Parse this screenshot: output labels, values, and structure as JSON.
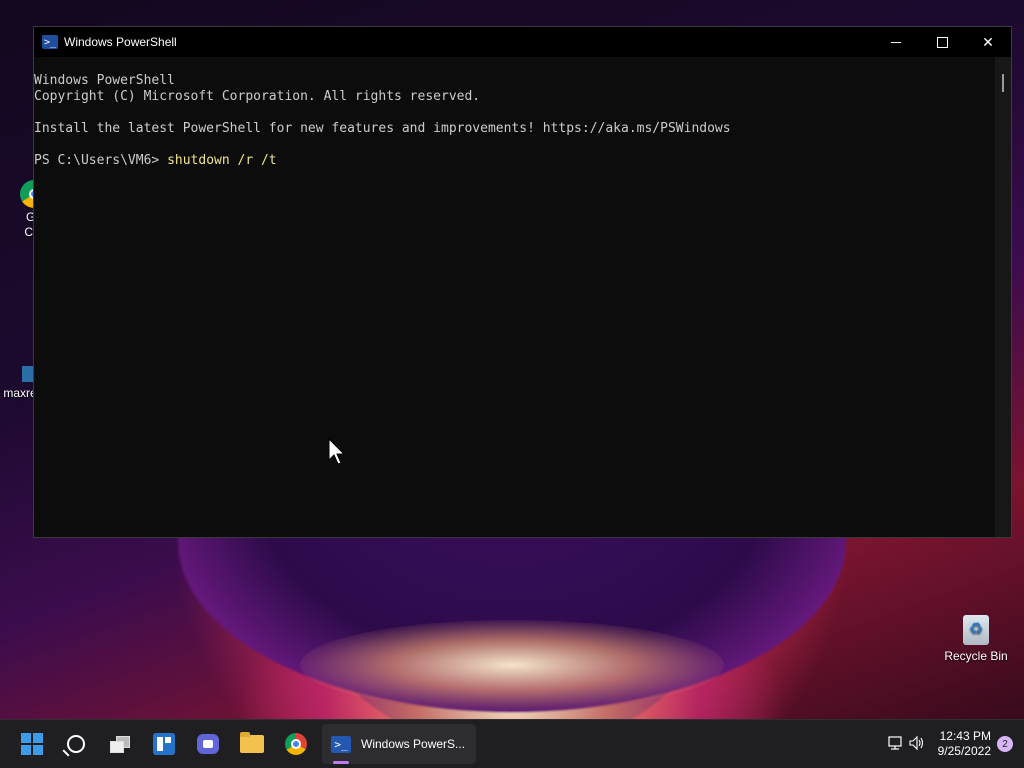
{
  "window": {
    "title": "Windows PowerShell",
    "buttons": {
      "minimize": "—",
      "maximize": "☐",
      "close": "✕"
    }
  },
  "console": {
    "lines": [
      "Windows PowerShell",
      "Copyright (C) Microsoft Corporation. All rights reserved.",
      "",
      "Install the latest PowerShell for new features and improvements! https://aka.ms/PSWindows",
      ""
    ],
    "prompt": "PS C:\\Users\\VM6> ",
    "command": "shutdown /r /t"
  },
  "desktop": {
    "icons": [
      {
        "label_line1": "Go",
        "label_line2": "Chr",
        "icon": "chrome-icon"
      },
      {
        "label": "maxre",
        "icon": "app-icon"
      },
      {
        "label": "Recycle Bin",
        "icon": "recycle-bin-icon"
      }
    ]
  },
  "taskbar": {
    "active_app_label": "Windows PowerS...",
    "time": "12:43 PM",
    "date": "9/25/2022",
    "notification_count": "2",
    "icons": [
      "start-icon",
      "search-icon",
      "task-view-icon",
      "widgets-icon",
      "chat-icon",
      "file-explorer-icon",
      "chrome-icon",
      "powershell-icon"
    ]
  },
  "colors": {
    "console_bg": "#0c0c0c",
    "console_text": "#cccccc",
    "command_text": "#f0e68c",
    "taskbar_bg": "#1f1f22",
    "accent": "#3d9be9"
  }
}
